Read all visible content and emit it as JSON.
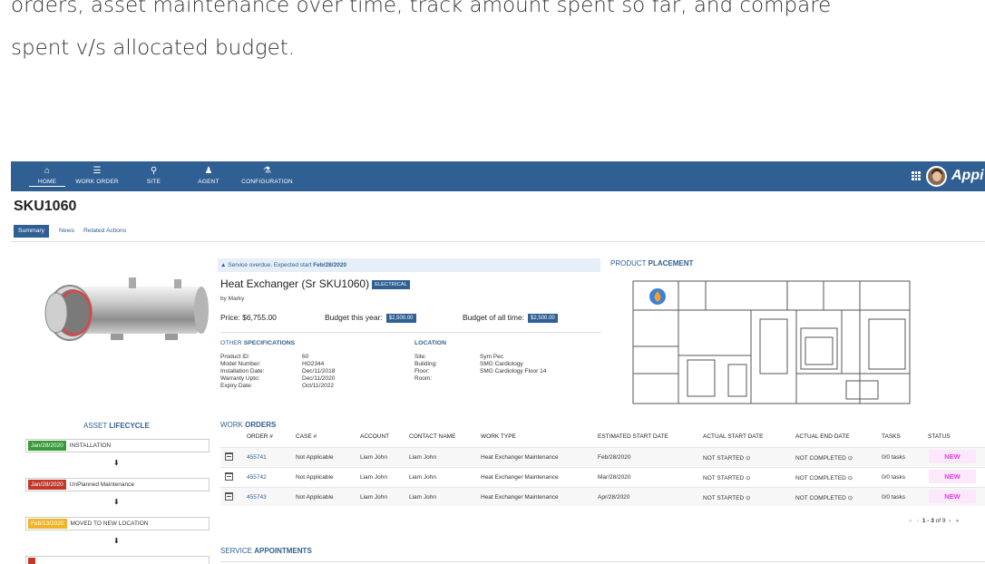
{
  "intro": {
    "line1": "orders, asset maintenance over time, track amount spent so far, and compare",
    "line2": "spent v/s allocated budget."
  },
  "nav": {
    "items": [
      {
        "label": "HOME",
        "icon": "home-icon"
      },
      {
        "label": "WORK ORDER",
        "icon": "list-icon"
      },
      {
        "label": "SITE",
        "icon": "map-pin-icon"
      },
      {
        "label": "AGENT",
        "icon": "person-icon"
      },
      {
        "label": "CONFIGURATION",
        "icon": "hierarchy-icon"
      }
    ],
    "brand": "Appi",
    "color": "#2f5f93"
  },
  "page": {
    "title": "SKU1060",
    "tabs": [
      "Summary",
      "News",
      "Related Actions"
    ]
  },
  "alert": {
    "text": "Service overdue. Expected start",
    "date": "Feb/28/2020"
  },
  "product": {
    "name": "Heat Exchanger (Sr SKU1060)",
    "category": "ELECTRICAL",
    "by": "by Marky",
    "price_label": "Price: $6,755.00",
    "budget_year_label": "Budget this year:",
    "budget_year": "$2,500.00",
    "budget_all_label": "Budget of all time:",
    "budget_all": "$2,500.00"
  },
  "specs": {
    "heading_light": "OTHER",
    "heading_bold": "SPECIFICATIONS",
    "rows": [
      {
        "k": "Product ID:",
        "v": "60"
      },
      {
        "k": "Model Number:",
        "v": "HO2344"
      },
      {
        "k": "Installation Date:",
        "v": "Dec/11/2018"
      },
      {
        "k": "Warranty Upto:",
        "v": "Dec/11/2020"
      },
      {
        "k": "Expiry Date:",
        "v": "Oct/11/2022"
      }
    ]
  },
  "location": {
    "heading": "LOCATION",
    "rows": [
      {
        "k": "Site:",
        "v": "Sym Pec"
      },
      {
        "k": "Building:",
        "v": "SMG Cardiology"
      },
      {
        "k": "Floor:",
        "v": "SMG Cardiology Floor 14"
      },
      {
        "k": "Room:",
        "v": ""
      }
    ]
  },
  "placement": {
    "heading_light": "PRODUCT",
    "heading_bold": "PLACEMENT"
  },
  "lifecycle": {
    "heading_light": "ASSET",
    "heading_bold": "LIFECYCLE",
    "events": [
      {
        "date": "Jan/28/2020",
        "label": "INSTALLATION",
        "color": "#3a9a3a"
      },
      {
        "date": "Jan/28/2020",
        "label": "UnPlanned Maintenance",
        "color": "#c0392b"
      },
      {
        "date": "Feb/13/2020",
        "label": "MOVED TO NEW LOCATION",
        "color": "#f0b429"
      }
    ]
  },
  "work_orders": {
    "heading_light": "WORK",
    "heading_bold": "ORDERS",
    "columns": [
      "ORDER #",
      "CASE #",
      "ACCOUNT",
      "CONTACT NAME",
      "WORK TYPE",
      "ESTIMATED START DATE",
      "ACTUAL START DATE",
      "ACTUAL END DATE",
      "TASKS",
      "STATUS"
    ],
    "rows": [
      {
        "order": "455741",
        "case": "Not Applicable",
        "account": "Liam John",
        "contact": "Liam John",
        "type": "Heat Exchanger Maintenance",
        "est": "Feb/28/2020",
        "start": "NOT STARTED ⊙",
        "end": "NOT COMPLETED ⊙",
        "tasks": "0/0 tasks",
        "status": "NEW"
      },
      {
        "order": "455742",
        "case": "Not Applicable",
        "account": "Liam John",
        "contact": "Liam John",
        "type": "Heat Exchanger Maintenance",
        "est": "Mar/28/2020",
        "start": "NOT STARTED ⊙",
        "end": "NOT COMPLETED ⊙",
        "tasks": "0/0 tasks",
        "status": "NEW"
      },
      {
        "order": "455743",
        "case": "Not Applicable",
        "account": "Liam John",
        "contact": "Liam John",
        "type": "Heat Exchanger Maintenance",
        "est": "Apr/28/2020",
        "start": "NOT STARTED ⊙",
        "end": "NOT COMPLETED ⊙",
        "tasks": "0/0 tasks",
        "status": "NEW"
      }
    ],
    "pager": {
      "first": "«",
      "prev": "‹",
      "range": "1 - 3",
      "of": "of 9",
      "next": "›",
      "last": "»"
    }
  },
  "service": {
    "heading_light": "SERVICE",
    "heading_bold": "APPOINTMENTS"
  }
}
